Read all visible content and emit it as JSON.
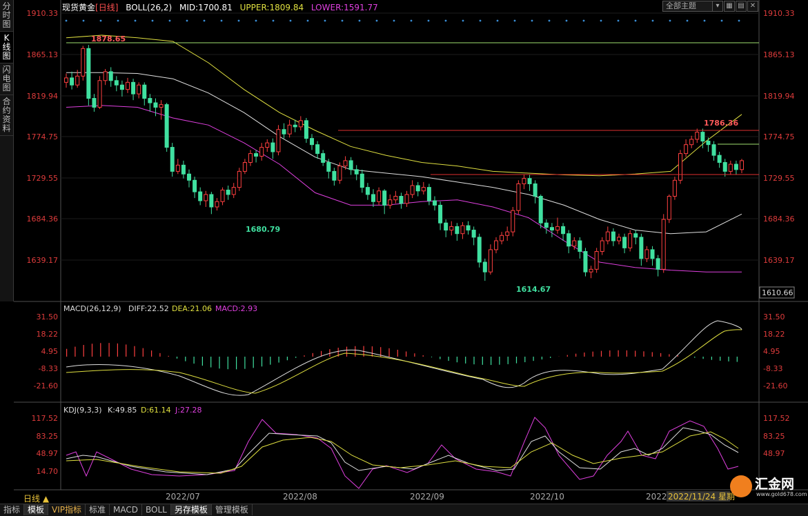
{
  "left_tabs": [
    "分时图",
    "K线图",
    "闪电图",
    "合约资料"
  ],
  "header": {
    "symbol": "现货黄金",
    "period": "[日线]",
    "boll_label": "BOLL(26,2)",
    "mid": "MID:1700.81",
    "upper": "UPPER:1809.84",
    "lower": "LOWER:1591.77"
  },
  "toolbar": {
    "theme": "全部主题",
    "icons": [
      "down-icon",
      "grid-icon",
      "layout-icon",
      "close-icon"
    ]
  },
  "main_axis": {
    "ticks": [
      "1910.33",
      "1865.13",
      "1819.94",
      "1774.75",
      "1729.55",
      "1684.36",
      "1639.17"
    ],
    "current_price": "1610.66"
  },
  "annotations": {
    "high_1": "1878.65",
    "low_1": "1680.79",
    "low_2": "1614.67",
    "high_2": "1786.36"
  },
  "macd": {
    "label": "MACD(26,12,9)",
    "diff": "DIFF:22.52",
    "dea": "DEA:21.06",
    "macd": "MACD:2.93",
    "ticks": [
      "31.50",
      "18.22",
      "4.95",
      "-8.33",
      "-21.60"
    ]
  },
  "kdj": {
    "label": "KDJ(9,3,3)",
    "k": "K:49.85",
    "d": "D:61.14",
    "j": "J:27.28",
    "ticks": [
      "117.52",
      "83.25",
      "48.97",
      "14.70"
    ]
  },
  "date_axis": [
    "2022/07",
    "2022/08",
    "2022/09",
    "2022/10",
    "2022"
  ],
  "cursor_date": "2022/11/24 星期",
  "timeframe": "日线 ▲",
  "bottom_tabs": [
    "指标",
    "模板",
    "VIP指标",
    "标准",
    "MACD",
    "BOLL",
    "另存模板",
    "管理模板"
  ],
  "watermark": {
    "brand": "汇金网",
    "site": "www.gold678.com"
  },
  "colors": {
    "up": "#ff4040",
    "down": "#40e0a0",
    "upper": "#e0e040",
    "mid": "#e0e0e0",
    "lower": "#e040e0"
  },
  "chart_data": {
    "type": "candlestick",
    "y_range": [
      1605,
      1915
    ],
    "candles": [
      [
        1838,
        1843,
        1832,
        1848
      ],
      [
        1843,
        1835,
        1830,
        1850
      ],
      [
        1835,
        1845,
        1832,
        1852
      ],
      [
        1845,
        1876,
        1840,
        1879
      ],
      [
        1876,
        1820,
        1812,
        1880
      ],
      [
        1820,
        1810,
        1805,
        1825
      ],
      [
        1810,
        1840,
        1808,
        1845
      ],
      [
        1840,
        1850,
        1835,
        1853
      ],
      [
        1850,
        1840,
        1833,
        1855
      ],
      [
        1840,
        1835,
        1828,
        1845
      ],
      [
        1835,
        1830,
        1822,
        1840
      ],
      [
        1830,
        1838,
        1826,
        1843
      ],
      [
        1838,
        1825,
        1818,
        1842
      ],
      [
        1825,
        1835,
        1820,
        1838
      ],
      [
        1835,
        1820,
        1812,
        1838
      ],
      [
        1820,
        1815,
        1805,
        1825
      ],
      [
        1815,
        1810,
        1800,
        1820
      ],
      [
        1810,
        1813,
        1796,
        1818
      ],
      [
        1813,
        1765,
        1760,
        1815
      ],
      [
        1765,
        1738,
        1732,
        1770
      ],
      [
        1738,
        1745,
        1735,
        1752
      ],
      [
        1745,
        1735,
        1730,
        1750
      ],
      [
        1735,
        1728,
        1720,
        1740
      ],
      [
        1728,
        1715,
        1708,
        1732
      ],
      [
        1715,
        1705,
        1700,
        1720
      ],
      [
        1705,
        1712,
        1698,
        1716
      ],
      [
        1712,
        1698,
        1690,
        1715
      ],
      [
        1698,
        1704,
        1694,
        1708
      ],
      [
        1704,
        1717,
        1700,
        1720
      ],
      [
        1717,
        1712,
        1706,
        1722
      ],
      [
        1712,
        1720,
        1708,
        1725
      ],
      [
        1720,
        1738,
        1716,
        1742
      ],
      [
        1738,
        1748,
        1735,
        1752
      ],
      [
        1748,
        1758,
        1744,
        1762
      ],
      [
        1758,
        1755,
        1748,
        1762
      ],
      [
        1755,
        1765,
        1750,
        1770
      ],
      [
        1765,
        1770,
        1760,
        1774
      ],
      [
        1770,
        1760,
        1752,
        1775
      ],
      [
        1760,
        1785,
        1756,
        1790
      ],
      [
        1785,
        1780,
        1775,
        1792
      ],
      [
        1780,
        1790,
        1776,
        1796
      ],
      [
        1790,
        1788,
        1782,
        1796
      ],
      [
        1788,
        1795,
        1784,
        1800
      ],
      [
        1795,
        1775,
        1770,
        1798
      ],
      [
        1775,
        1768,
        1762,
        1780
      ],
      [
        1768,
        1758,
        1752,
        1772
      ],
      [
        1758,
        1748,
        1744,
        1762
      ],
      [
        1748,
        1738,
        1730,
        1752
      ],
      [
        1738,
        1728,
        1722,
        1742
      ],
      [
        1728,
        1744,
        1724,
        1748
      ],
      [
        1744,
        1750,
        1740,
        1755
      ],
      [
        1750,
        1740,
        1734,
        1754
      ],
      [
        1740,
        1735,
        1728,
        1745
      ],
      [
        1735,
        1720,
        1714,
        1740
      ],
      [
        1720,
        1712,
        1706,
        1725
      ],
      [
        1712,
        1704,
        1698,
        1718
      ],
      [
        1704,
        1716,
        1700,
        1720
      ],
      [
        1716,
        1700,
        1690,
        1718
      ],
      [
        1700,
        1706,
        1696,
        1712
      ],
      [
        1706,
        1710,
        1702,
        1716
      ],
      [
        1710,
        1702,
        1696,
        1714
      ],
      [
        1702,
        1712,
        1698,
        1716
      ],
      [
        1712,
        1722,
        1708,
        1728
      ],
      [
        1722,
        1716,
        1710,
        1726
      ],
      [
        1716,
        1720,
        1712,
        1726
      ],
      [
        1720,
        1705,
        1700,
        1724
      ],
      [
        1705,
        1700,
        1694,
        1710
      ],
      [
        1700,
        1680,
        1672,
        1704
      ],
      [
        1680,
        1672,
        1664,
        1684
      ],
      [
        1672,
        1676,
        1666,
        1682
      ],
      [
        1676,
        1668,
        1660,
        1680
      ],
      [
        1668,
        1677,
        1662,
        1681
      ],
      [
        1677,
        1672,
        1667,
        1682
      ],
      [
        1672,
        1664,
        1655,
        1676
      ],
      [
        1664,
        1636,
        1630,
        1668
      ],
      [
        1636,
        1625,
        1615,
        1640
      ],
      [
        1625,
        1650,
        1622,
        1656
      ],
      [
        1650,
        1660,
        1646,
        1664
      ],
      [
        1660,
        1666,
        1656,
        1670
      ],
      [
        1666,
        1670,
        1660,
        1676
      ],
      [
        1670,
        1694,
        1665,
        1698
      ],
      [
        1694,
        1724,
        1690,
        1728
      ],
      [
        1724,
        1730,
        1718,
        1734
      ],
      [
        1730,
        1724,
        1716,
        1734
      ],
      [
        1724,
        1710,
        1702,
        1728
      ],
      [
        1710,
        1680,
        1674,
        1712
      ],
      [
        1680,
        1675,
        1668,
        1684
      ],
      [
        1675,
        1672,
        1664,
        1680
      ],
      [
        1672,
        1676,
        1668,
        1686
      ],
      [
        1676,
        1668,
        1660,
        1680
      ],
      [
        1668,
        1654,
        1646,
        1672
      ],
      [
        1654,
        1660,
        1650,
        1664
      ],
      [
        1660,
        1648,
        1640,
        1664
      ],
      [
        1648,
        1625,
        1620,
        1652
      ],
      [
        1625,
        1628,
        1618,
        1632
      ],
      [
        1628,
        1648,
        1624,
        1652
      ],
      [
        1648,
        1660,
        1644,
        1664
      ],
      [
        1660,
        1670,
        1656,
        1676
      ],
      [
        1670,
        1660,
        1654,
        1674
      ],
      [
        1660,
        1664,
        1656,
        1668
      ],
      [
        1664,
        1652,
        1646,
        1668
      ],
      [
        1652,
        1668,
        1648,
        1672
      ],
      [
        1668,
        1664,
        1656,
        1672
      ],
      [
        1664,
        1640,
        1632,
        1668
      ],
      [
        1640,
        1650,
        1636,
        1654
      ],
      [
        1650,
        1640,
        1632,
        1654
      ],
      [
        1640,
        1628,
        1620,
        1644
      ],
      [
        1628,
        1684,
        1624,
        1690
      ],
      [
        1684,
        1710,
        1680,
        1712
      ],
      [
        1710,
        1728,
        1706,
        1732
      ],
      [
        1728,
        1758,
        1724,
        1762
      ],
      [
        1758,
        1768,
        1754,
        1774
      ],
      [
        1768,
        1774,
        1764,
        1778
      ],
      [
        1774,
        1782,
        1770,
        1786
      ],
      [
        1782,
        1772,
        1764,
        1786
      ],
      [
        1772,
        1768,
        1760,
        1776
      ],
      [
        1768,
        1756,
        1750,
        1772
      ],
      [
        1756,
        1748,
        1742,
        1760
      ],
      [
        1748,
        1738,
        1732,
        1752
      ],
      [
        1738,
        1746,
        1734,
        1750
      ],
      [
        1746,
        1740,
        1734,
        1750
      ],
      [
        1740,
        1750,
        1736,
        1752
      ]
    ],
    "boll_upper": [
      1888,
      1891,
      1888,
      1884,
      1860,
      1830,
      1804,
      1784,
      1766,
      1756,
      1748,
      1744,
      1738,
      1736,
      1734,
      1733,
      1735,
      1738,
      1772,
      1802
    ],
    "boll_mid": [
      1849,
      1849,
      1848,
      1842,
      1826,
      1804,
      1777,
      1754,
      1740,
      1736,
      1732,
      1726,
      1720,
      1712,
      1700,
      1684,
      1672,
      1668,
      1670,
      1690
    ],
    "boll_lower": [
      1810,
      1812,
      1810,
      1798,
      1790,
      1770,
      1746,
      1714,
      1700,
      1700,
      1704,
      1706,
      1698,
      1686,
      1660,
      1636,
      1630,
      1627,
      1625,
      1625
    ]
  }
}
